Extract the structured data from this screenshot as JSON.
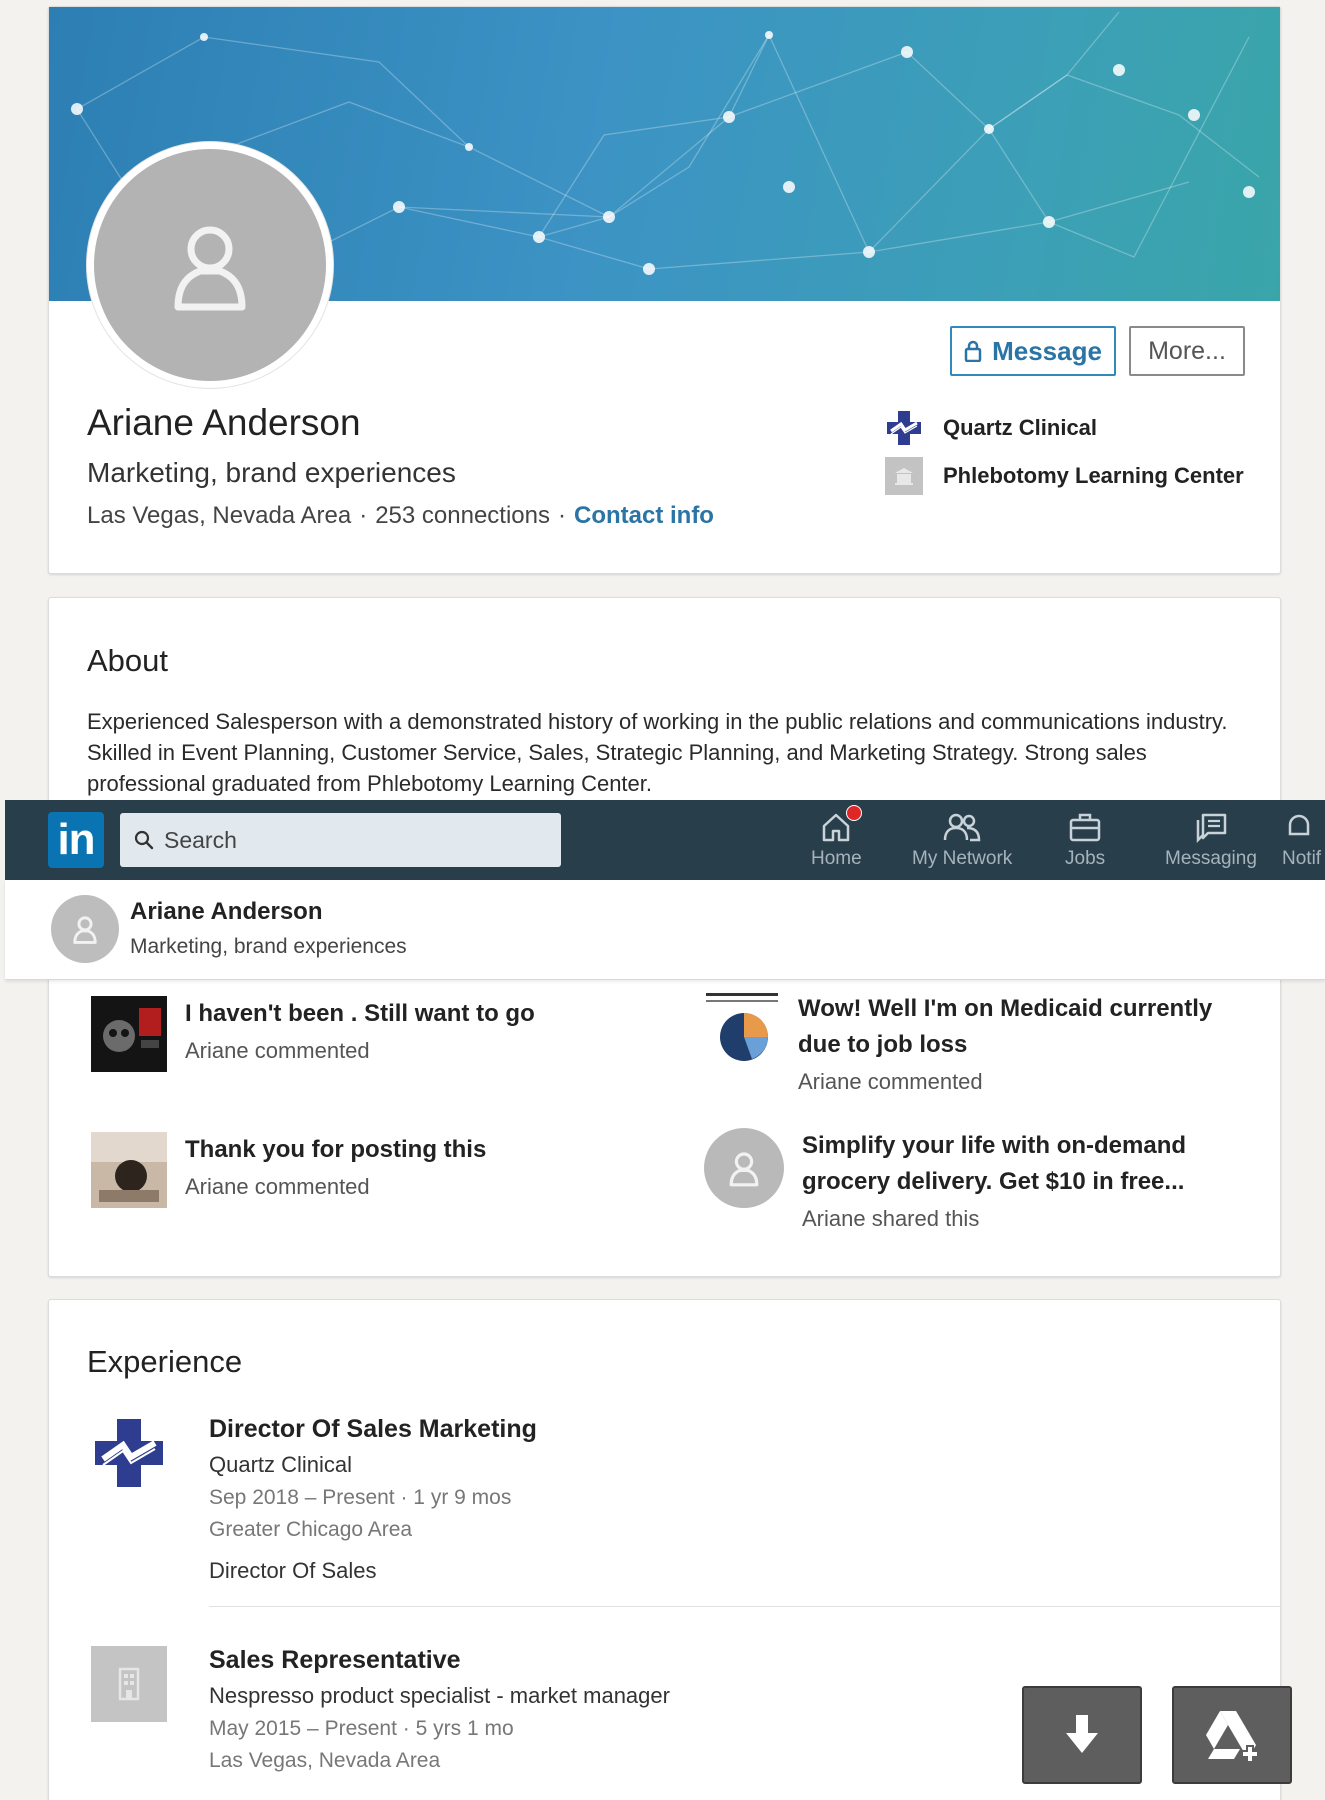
{
  "profile": {
    "name": "Ariane Anderson",
    "headline": "Marketing, brand experiences",
    "location": "Las Vegas, Nevada Area",
    "connections": "253 connections",
    "contact_info": "Contact info",
    "message_label": "Message",
    "more_label": "More...",
    "companies": [
      {
        "name": "Quartz Clinical",
        "icon": "quartz-clinical-logo"
      },
      {
        "name": "Phlebotomy Learning Center",
        "icon": "school-building-icon"
      }
    ]
  },
  "about": {
    "title": "About",
    "text": "Experienced Salesperson with a demonstrated history of working in the public relations and communications industry. Skilled in Event Planning, Customer Service, Sales, Strategic Planning, and Marketing Strategy. Strong sales professional graduated from Phlebotomy Learning Center."
  },
  "navbar": {
    "logo": "in",
    "search_placeholder": "Search",
    "items": [
      {
        "label": "Home",
        "icon": "home-icon"
      },
      {
        "label": "My Network",
        "icon": "network-icon"
      },
      {
        "label": "Jobs",
        "icon": "briefcase-icon"
      },
      {
        "label": "Messaging",
        "icon": "messaging-icon"
      },
      {
        "label": "Notif",
        "icon": "bell-icon"
      }
    ]
  },
  "mini_profile": {
    "name": "Ariane Anderson",
    "headline": "Marketing, brand experiences"
  },
  "activity": [
    {
      "title": "I haven't been . Still want to go",
      "subtitle": "Ariane commented"
    },
    {
      "title": "Wow! Well I'm on Medicaid currently due to job loss",
      "subtitle": "Ariane commented"
    },
    {
      "title": "Thank you for posting this",
      "subtitle": "Ariane commented"
    },
    {
      "title": "Simplify your life with on-demand grocery delivery. Get $10 in free...",
      "subtitle": "Ariane shared this"
    }
  ],
  "experience": {
    "title": "Experience",
    "items": [
      {
        "role": "Director Of Sales Marketing",
        "company": "Quartz Clinical",
        "dates": "Sep 2018 – Present · 1 yr 9 mos",
        "location": "Greater Chicago Area",
        "description": "Director Of Sales"
      },
      {
        "role": "Sales Representative",
        "company": "Nespresso product specialist - market manager",
        "dates": "May 2015 – Present · 5 yrs 1 mo",
        "location": "Las Vegas, Nevada Area"
      }
    ]
  },
  "colors": {
    "accent": "#2a74a6",
    "nav_bg": "#283e4a",
    "linkedin_blue": "#0a74b3"
  }
}
